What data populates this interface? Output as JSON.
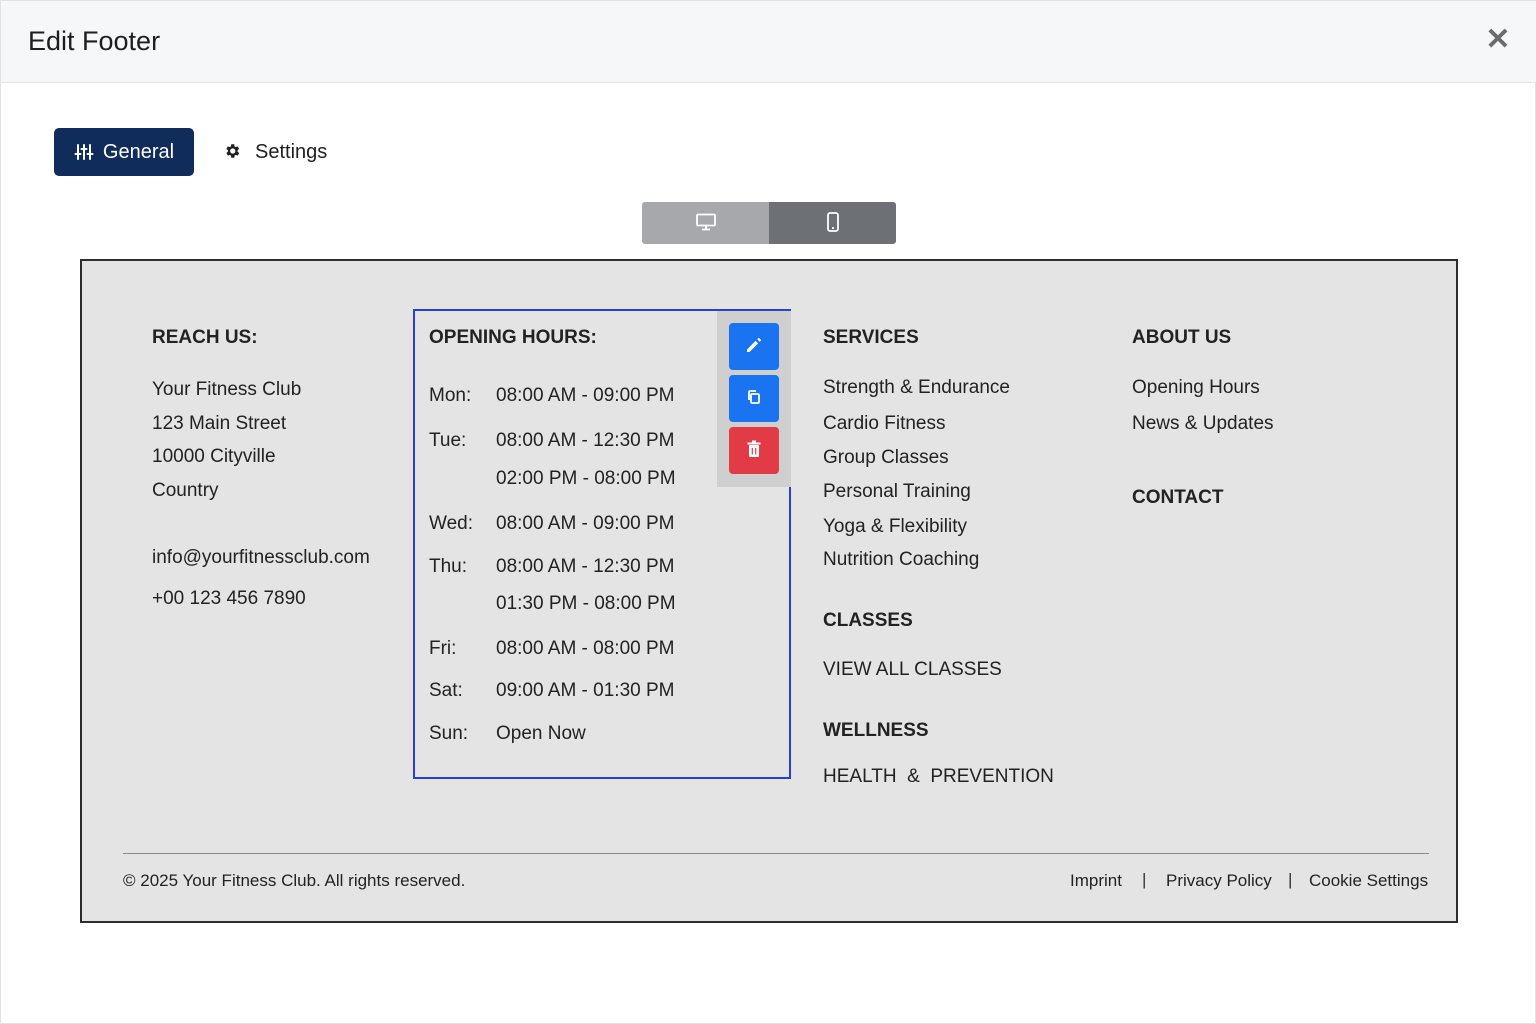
{
  "modal": {
    "title": "Edit Footer",
    "close_glyph": "✕"
  },
  "tabs": [
    {
      "label": "General",
      "icon": "sliders-icon",
      "active": true
    },
    {
      "label": "Settings",
      "icon": "gear-icon",
      "active": false
    }
  ],
  "device_toggle": {
    "options": [
      "desktop-icon",
      "mobile-icon"
    ],
    "selected": "mobile"
  },
  "footer": {
    "reach_us": {
      "heading": "REACH US:",
      "lines": [
        "Your Fitness Club",
        "123 Main Street",
        "10000 Cityville",
        "Country"
      ],
      "email": "info@yourfitnessclub.com",
      "phone": "+00 123 456 7890"
    },
    "opening_hours": {
      "heading": "OPENING HOURS:",
      "rows": [
        {
          "day": "Mon:",
          "time": "08:00 AM - 09:00 PM"
        },
        {
          "day": "Tue:",
          "time": "08:00 AM - 12:30 PM"
        },
        {
          "day": "",
          "time": "02:00 PM - 08:00 PM"
        },
        {
          "day": "Wed:",
          "time": "08:00 AM - 09:00 PM"
        },
        {
          "day": "Thu:",
          "time": "08:00 AM - 12:30 PM"
        },
        {
          "day": "",
          "time": "01:30 PM - 08:00 PM"
        },
        {
          "day": "Fri:",
          "time": "08:00 AM - 08:00 PM"
        },
        {
          "day": "Sat:",
          "time": "09:00 AM - 01:30 PM"
        },
        {
          "day": "Sun:",
          "time": "Open Now"
        }
      ]
    },
    "services": {
      "heading": "SERVICES",
      "items": [
        "Strength & Endurance",
        "Cardio Fitness",
        "Group Classes",
        "Personal Training",
        "Yoga & Flexibility",
        "Nutrition Coaching"
      ]
    },
    "classes": {
      "heading": "CLASSES",
      "link": "VIEW ALL CLASSES"
    },
    "wellness": {
      "heading": "WELLNESS",
      "link": "HEALTH  &  PREVENTION"
    },
    "about_us": {
      "heading": "ABOUT US",
      "items": [
        "Opening Hours",
        "News & Updates"
      ]
    },
    "contact": {
      "heading": "CONTACT"
    },
    "bottom": {
      "copyright": "© 2025 Your Fitness Club. All rights reserved.",
      "links": [
        "Imprint",
        "Privacy Policy",
        "Cookie Settings"
      ],
      "separator": "|"
    }
  },
  "block_actions": [
    "edit-icon",
    "copy-icon",
    "delete-icon"
  ],
  "colors": {
    "primary": "#0f2c5a",
    "action_blue": "#1a73f0",
    "action_red": "#e23b46",
    "selection": "#2b3fd1",
    "preview_bg": "#e4e4e4"
  }
}
